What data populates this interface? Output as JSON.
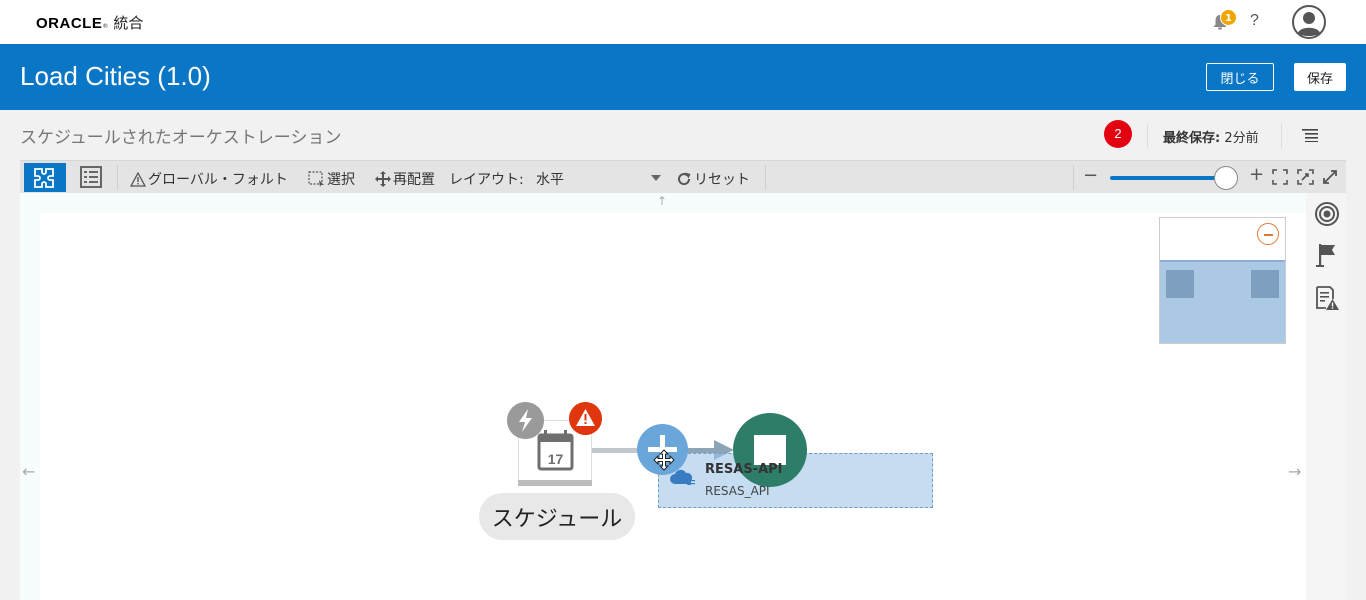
{
  "header": {
    "brand": "ORACLE",
    "product": "統合",
    "notifications_count": "1",
    "help_label": "?"
  },
  "titlebar": {
    "title": "Load Cities (1.0)",
    "close_label": "閉じる",
    "save_label": "保存"
  },
  "subheader": {
    "subtitle": "スケジュールされたオーケストレーション",
    "error_count": "2",
    "last_saved_label": "最終保存:",
    "last_saved_value": "2分前"
  },
  "toolbar": {
    "global_fault": "グローバル・フォルト",
    "select": "選択",
    "rearrange": "再配置",
    "layout_label": "レイアウト:",
    "layout_value": "水平",
    "reset": "リセット",
    "zoom_level": 0.92
  },
  "canvas": {
    "schedule_label": "スケジュール",
    "schedule_day": "17",
    "api_name": "RESAS-API",
    "api_identifier": "RESAS_API"
  },
  "colors": {
    "brand_blue": "#0a76c6",
    "error_red": "#e30011",
    "warning_orange": "#e0360e",
    "invoke_green": "#2e7d68",
    "notification_amber": "#f0a500"
  },
  "icons": [
    "bell-icon",
    "help-icon",
    "avatar-icon",
    "puzzle-icon",
    "list-view-icon",
    "warning-icon",
    "select-icon",
    "move-icon",
    "reset-icon",
    "fit-icon",
    "focus-icon",
    "fullscreen-icon",
    "target-icon",
    "flag-icon",
    "report-warning-icon"
  ]
}
